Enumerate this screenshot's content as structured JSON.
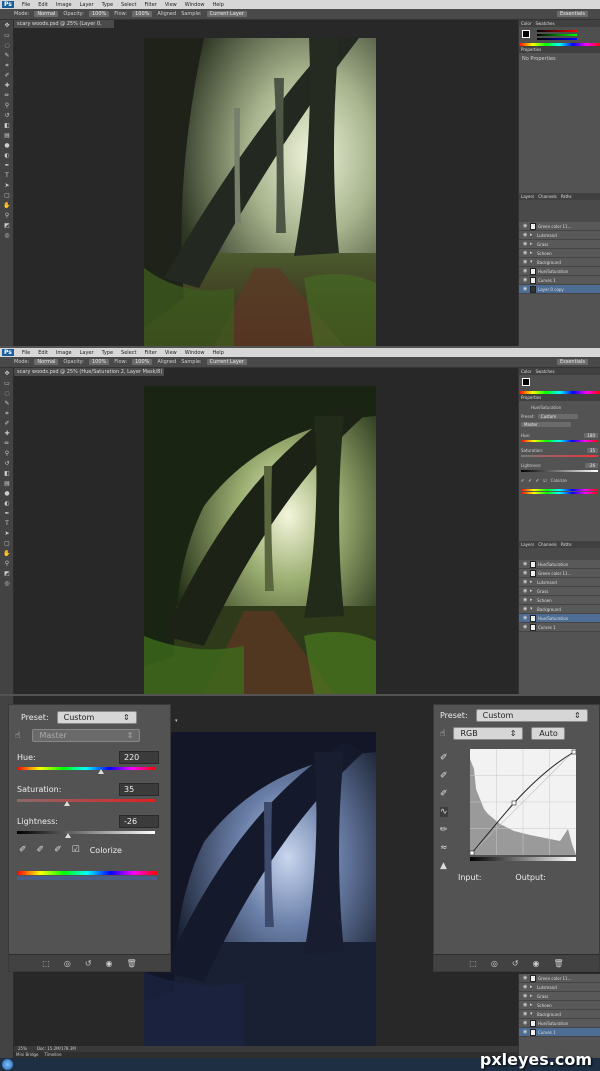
{
  "menu": {
    "logo": "Ps",
    "items": [
      "File",
      "Edit",
      "Image",
      "Layer",
      "Type",
      "Select",
      "Filter",
      "View",
      "Window",
      "Help"
    ]
  },
  "options": {
    "mode_label": "Mode:",
    "mode_value": "Normal",
    "opacity_label": "Opacity:",
    "opacity_value": "100%",
    "flow_label": "Flow:",
    "flow_value": "100%",
    "aligned": "Aligned",
    "sample_label": "Sample:",
    "sample_value": "Current Layer",
    "workspace": "Essentials"
  },
  "shot1": {
    "doc_tab": "scary woods.psd @ 25% (Layer 0, RGB/8) *",
    "properties_title": "Properties",
    "no_properties": "No Properties",
    "layers_tabs": [
      "Layers",
      "Channels",
      "Paths"
    ],
    "layers": [
      "Green color 11...",
      "Lutsmand",
      "Grass",
      "Schoen",
      "Background",
      "Hue/Saturation",
      "Curves 1",
      "Layer 0 copy"
    ]
  },
  "shot2": {
    "doc_tab": "scary woods.psd @ 25% (Hue/Saturation 2, Layer Mask/8) *",
    "properties_title": "Properties",
    "adj_title": "Hue/Saturation",
    "preset_label": "Preset:",
    "preset_value": "Custom",
    "channel_value": "Master",
    "hue_label": "Hue:",
    "hue_value": "180",
    "sat_label": "Saturation:",
    "sat_value": "35",
    "light_label": "Lightness:",
    "light_value": "-26",
    "colorize": "Colorize",
    "layers": [
      "Hue/Saturation",
      "Green color 11...",
      "Lutsmand",
      "Grass",
      "Schoen",
      "Background",
      "Hue/Saturation",
      "Curves 1"
    ]
  },
  "huesat": {
    "preset_label": "Preset:",
    "preset_value": "Custom",
    "channel_value": "Master",
    "hue_label": "Hue:",
    "hue_value": "220",
    "hue_fraction": 0.61,
    "sat_label": "Saturation:",
    "sat_value": "35",
    "sat_fraction": 0.36,
    "light_label": "Lightness:",
    "light_value": "-26",
    "light_fraction": 0.37,
    "colorize_label": "Colorize",
    "colorize_checked": true
  },
  "curves": {
    "preset_label": "Preset:",
    "preset_value": "Custom",
    "channel_value": "RGB",
    "auto_label": "Auto",
    "input_label": "Input:",
    "output_label": "Output:"
  },
  "shot3": {
    "zoom": "25%",
    "doc_info": "Doc: 15.2M/178.3M",
    "mini_bridge": "Mini Bridge",
    "timeline": "Timeline",
    "layers": [
      "Green color 11...",
      "Lutsmand",
      "Grass",
      "Schoen",
      "Background",
      "Hue/Saturation",
      "Curves 1"
    ]
  },
  "watermark": "pxleyes.com",
  "colors": {
    "accent_selected": "#4d6d95",
    "ps_blue": "#1c5f9d"
  }
}
